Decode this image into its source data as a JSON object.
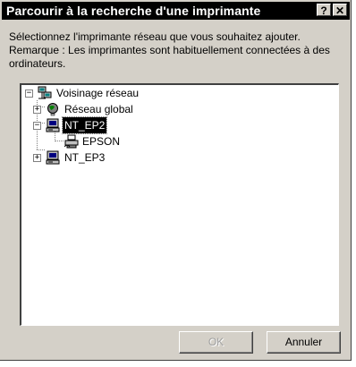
{
  "window": {
    "title": "Parcourir à la recherche d'une imprimante",
    "help_label": "?",
    "close_label": "✕"
  },
  "description": {
    "line1": "Sélectionnez l'imprimante réseau que vous souhaitez ajouter.",
    "line2": "Remarque : Les imprimantes sont habituellement connectées à des ordinateurs."
  },
  "tree": {
    "root": {
      "label": "Voisinage réseau",
      "expander": "−",
      "icon": "network-neighborhood-icon"
    },
    "items": [
      {
        "label": "Réseau global",
        "expander": "+",
        "icon": "globe-icon",
        "selected": false
      },
      {
        "label": "NT_EP2",
        "expander": "−",
        "icon": "computer-icon",
        "selected": true
      },
      {
        "label": "EPSON",
        "expander": "",
        "icon": "printer-icon",
        "selected": false
      },
      {
        "label": "NT_EP3",
        "expander": "+",
        "icon": "computer-icon",
        "selected": false
      }
    ]
  },
  "buttons": {
    "ok_label": "OK",
    "cancel_label": "Annuler"
  }
}
